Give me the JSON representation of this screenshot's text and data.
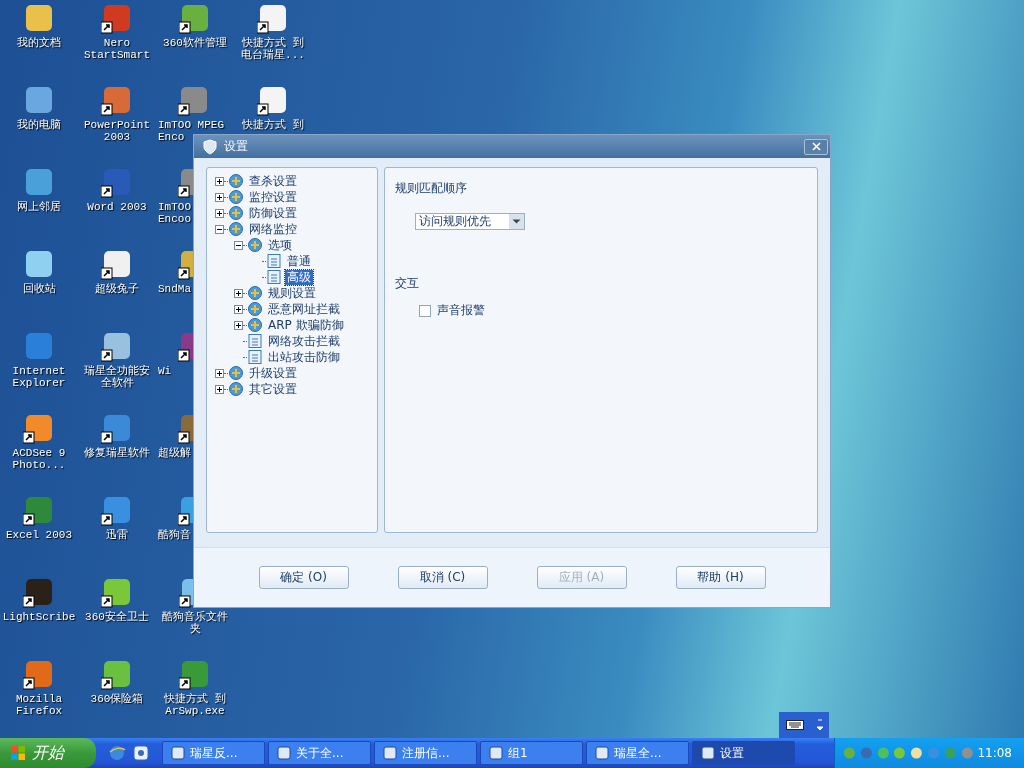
{
  "desktop_icons": [
    {
      "label": "我的文档",
      "shortcut": false,
      "color": "#e8c04a"
    },
    {
      "label": "我的电脑",
      "shortcut": false,
      "color": "#6aa6e0"
    },
    {
      "label": "网上邻居",
      "shortcut": false,
      "color": "#4aa0d8"
    },
    {
      "label": "回收站",
      "shortcut": false,
      "color": "#8fd0f0"
    },
    {
      "label": "Internet Explorer",
      "shortcut": false,
      "color": "#2a7fd8"
    },
    {
      "label": "ACDSee 9 Photo...",
      "shortcut": true,
      "color": "#f08a2a"
    },
    {
      "label": "Excel 2003",
      "shortcut": true,
      "color": "#2e8a3a"
    },
    {
      "label": "LightScribe",
      "shortcut": true,
      "color": "#2a2218"
    },
    {
      "label": "Mozilla Firefox",
      "shortcut": true,
      "color": "#e06a1a"
    },
    {
      "label": "Nero StartSmart",
      "shortcut": true,
      "color": "#d03a20"
    },
    {
      "label": "PowerPoint 2003",
      "shortcut": true,
      "color": "#d86a3a"
    },
    {
      "label": "Word 2003",
      "shortcut": true,
      "color": "#2a5ab8"
    },
    {
      "label": "超级兔子",
      "shortcut": true,
      "color": "#f0f0f0"
    },
    {
      "label": "瑞星全功能安全软件",
      "shortcut": true,
      "color": "#9ac0e0"
    },
    {
      "label": "修复瑞星软件",
      "shortcut": true,
      "color": "#3a8ad8"
    },
    {
      "label": "迅雷",
      "shortcut": true,
      "color": "#3a90e0"
    },
    {
      "label": "360安全卫士",
      "shortcut": true,
      "color": "#7ac83a"
    },
    {
      "label": "360保险箱",
      "shortcut": true,
      "color": "#6ac040"
    },
    {
      "label": "360软件管理",
      "shortcut": true,
      "color": "#6ab040"
    },
    {
      "label": "ImTOO MPEG Enco",
      "shortcut": true,
      "color": "#8a8a8a"
    },
    {
      "label": "ImTOO Encoo",
      "shortcut": true,
      "color": "#8a8a8a"
    },
    {
      "label": "SndMa",
      "shortcut": true,
      "color": "#d0b040"
    },
    {
      "label": "Wi",
      "shortcut": true,
      "color": "#8a3a8a"
    },
    {
      "label": "超级解",
      "shortcut": true,
      "color": "#8a6a3a"
    },
    {
      "label": "酷狗音",
      "shortcut": true,
      "color": "#3aa0e0"
    },
    {
      "label": "酷狗音乐文件夹",
      "shortcut": true,
      "color": "#7ac0e8"
    },
    {
      "label": "快捷方式 到 ArSwp.exe",
      "shortcut": true,
      "color": "#3a9a3a"
    },
    {
      "label": "快捷方式 到电台瑞星...",
      "shortcut": true,
      "color": "#f4f4f4"
    },
    {
      "label": "快捷方式 到",
      "shortcut": true,
      "color": "#f4f4f4"
    }
  ],
  "dialog": {
    "title": "设置",
    "tree": [
      {
        "label": "查杀设置",
        "expanded": false,
        "selected": false
      },
      {
        "label": "监控设置",
        "expanded": false,
        "selected": false
      },
      {
        "label": "防御设置",
        "expanded": false,
        "selected": false
      },
      {
        "label": "网络监控",
        "expanded": true,
        "selected": false,
        "children": [
          {
            "label": "选项",
            "expanded": true,
            "selected": false,
            "children": [
              {
                "label": "普通",
                "selected": false
              },
              {
                "label": "高级",
                "selected": true
              }
            ]
          },
          {
            "label": "规则设置",
            "expanded": false,
            "selected": false
          },
          {
            "label": "恶意网址拦截",
            "expanded": false,
            "selected": false
          },
          {
            "label": "ARP 欺骗防御",
            "expanded": false,
            "selected": false
          },
          {
            "label": "网络攻击拦截",
            "selected": false
          },
          {
            "label": "出站攻击防御",
            "selected": false
          }
        ]
      },
      {
        "label": "升级设置",
        "expanded": false,
        "selected": false
      },
      {
        "label": "其它设置",
        "expanded": false,
        "selected": false
      }
    ],
    "rule_order": {
      "label": "规则匹配顺序",
      "value": "访问规则优先"
    },
    "interaction": {
      "label": "交互",
      "sound_alarm": {
        "label": "声音报警",
        "checked": false
      }
    },
    "buttons": [
      {
        "label": "确定 (O)",
        "disabled": false
      },
      {
        "label": "取消 (C)",
        "disabled": false
      },
      {
        "label": "应用 (A)",
        "disabled": true
      },
      {
        "label": "帮助 (H)",
        "disabled": false
      }
    ]
  },
  "taskbar": {
    "start": "开始",
    "tasks": [
      {
        "label": "瑞星反...",
        "selected": false
      },
      {
        "label": "关于全...",
        "selected": false
      },
      {
        "label": "注册信...",
        "selected": false
      },
      {
        "label": "组1",
        "selected": false
      },
      {
        "label": "瑞星全...",
        "selected": false
      },
      {
        "label": "设置",
        "selected": true
      }
    ],
    "clock": "11:08"
  }
}
